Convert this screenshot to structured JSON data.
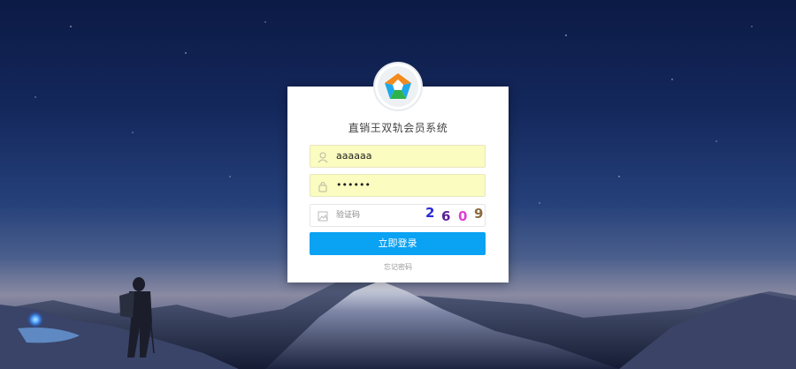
{
  "app": {
    "title": "直销王双轨会员系统"
  },
  "login_form": {
    "username": {
      "value": "aaaaaa",
      "icon": "user-icon"
    },
    "password": {
      "value": "••••••",
      "icon": "lock-icon"
    },
    "captcha": {
      "placeholder": "验证码",
      "icon": "image-icon",
      "code_digits": [
        "2",
        "6",
        "0",
        "9"
      ],
      "digit_colors": [
        "#2b2ad6",
        "#5a1f9a",
        "#e03fd2",
        "#8a6a3f"
      ]
    },
    "submit_label": "立即登录",
    "forgot_label": "忘记密码"
  },
  "colors": {
    "accent": "#0aa2f3",
    "autofill_yellow": "#fafcc0"
  }
}
